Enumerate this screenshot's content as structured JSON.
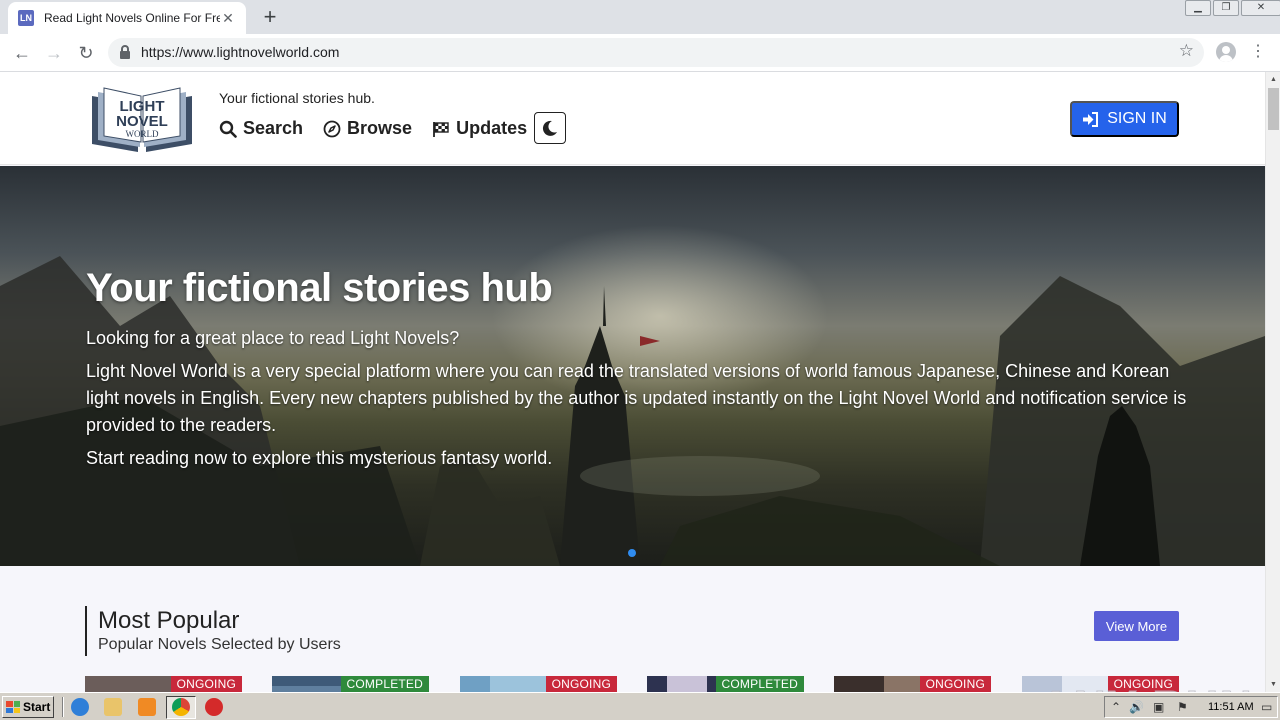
{
  "browser": {
    "tab_title": "Read Light Novels Online For Free | L",
    "tab_favicon_text": "LN",
    "url": "https://www.lightnovelworld.com",
    "icons": [
      "back-arrow-icon",
      "forward-arrow-icon",
      "reload-icon",
      "lock-icon",
      "star-icon",
      "profile-icon",
      "menu-dots-icon"
    ]
  },
  "site": {
    "logo_text": [
      "LIGHT",
      "NOVEL",
      "WORLD"
    ],
    "tagline": "Your fictional stories hub.",
    "nav": [
      {
        "label": "Search",
        "icon": "search-icon"
      },
      {
        "label": "Browse",
        "icon": "compass-icon"
      },
      {
        "label": "Updates",
        "icon": "checkered-flag-icon"
      }
    ],
    "theme_toggle_icon": "moon-icon",
    "signin_label": "SIGN IN",
    "accent": "#2563eb"
  },
  "hero": {
    "title": "Your fictional stories hub",
    "paragraphs": [
      "Looking for a great place to read Light Novels?",
      "Light Novel World is a very special platform where you can read the translated versions of world famous Japanese, Chinese and Korean light novels in English. Every new chapters published by the author is updated instantly on the Light Novel World and notification service is provided to the readers.",
      "Start reading now to explore this mysterious fantasy world."
    ]
  },
  "popular": {
    "title": "Most Popular",
    "subtitle": "Popular Novels Selected by Users",
    "view_more": "View More",
    "cards": [
      {
        "status": "ONGOING",
        "color": "#c8283b"
      },
      {
        "status": "COMPLETED",
        "color": "#2f8a3c"
      },
      {
        "status": "ONGOING",
        "color": "#c8283b"
      },
      {
        "status": "COMPLETED",
        "color": "#2f8a3c"
      },
      {
        "status": "ONGOING",
        "color": "#c8283b"
      },
      {
        "status": "ONGOING",
        "color": "#c8283b"
      }
    ]
  },
  "watermark": "ANY RUN",
  "taskbar": {
    "start_label": "Start",
    "clock": "11:51 AM"
  }
}
